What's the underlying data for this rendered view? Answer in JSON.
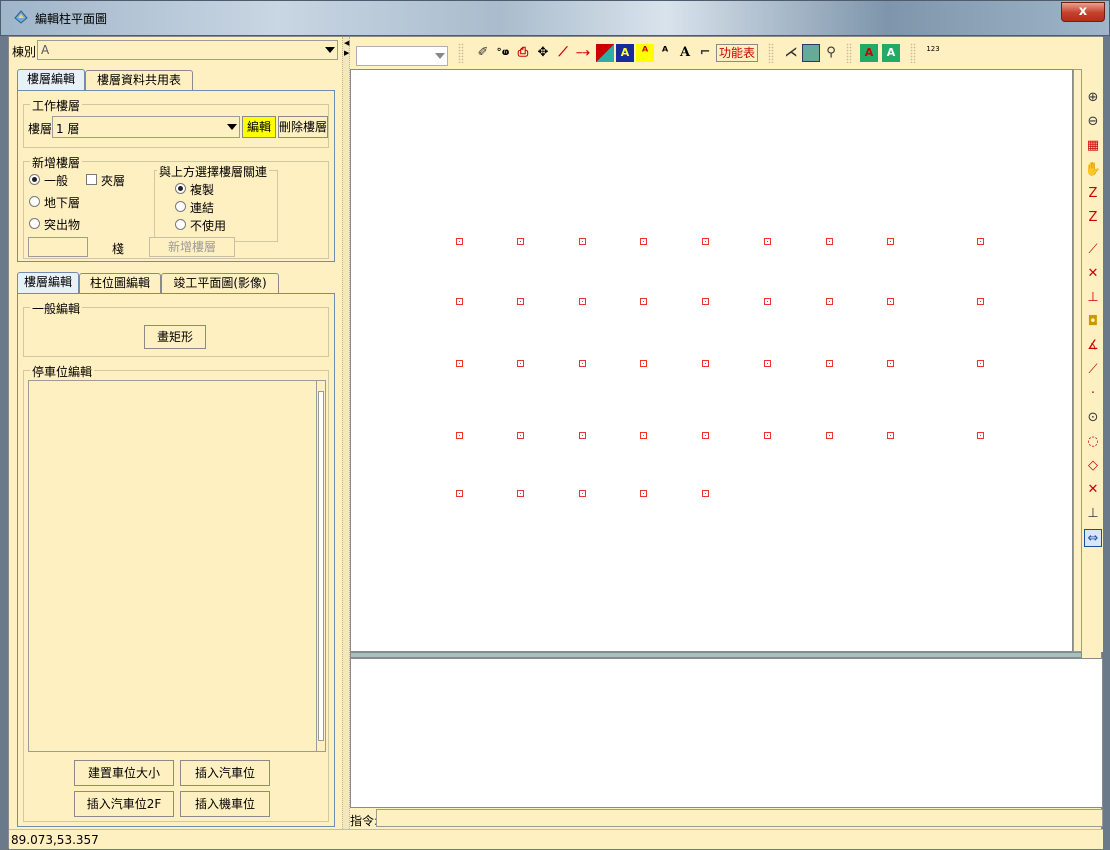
{
  "window": {
    "title": "編輯柱平面圖",
    "close": "x"
  },
  "left": {
    "building_label": "棟別",
    "building_value": "A",
    "top_tabs": [
      "樓層編輯",
      "樓層資料共用表"
    ],
    "work_floor": {
      "group_title": "工作樓層",
      "floor_label": "樓層",
      "floor_value": "1 層",
      "edit_button": "編輯",
      "delete_button": "刪除樓層"
    },
    "new_floor": {
      "group_title": "新增樓層",
      "types": [
        "一般",
        "地下層",
        "突出物"
      ],
      "selected_type": "一般",
      "mezzanine": "夾層",
      "relation_title": "與上方選擇樓層關連",
      "relations": [
        "複製",
        "連結",
        "不使用"
      ],
      "selected_relation": "複製",
      "count_value": "",
      "count_unit": "棧",
      "add_button": "新增樓層"
    },
    "bottom_tabs": [
      "樓層編輯",
      "柱位圖編輯",
      "竣工平面圖(影像)"
    ],
    "general_edit": {
      "group_title": "一般編輯",
      "draw_rect": "畫矩形"
    },
    "parking_edit": {
      "group_title": "停車位編輯",
      "items": []
    },
    "parking_buttons": [
      "建置車位大小",
      "插入汽車位",
      "插入汽車位2F",
      "插入機車位"
    ]
  },
  "toolbar": {
    "layer_combo_value": "",
    "function_table": "功能表",
    "icons": [
      "pencil-icon",
      "snap-icon",
      "stamp-icon",
      "move-icon",
      "line-icon",
      "extend-icon",
      "fill-icon",
      "text-red-icon",
      "text-style-icon",
      "text-angle-icon",
      "text-icon",
      "stairs-icon",
      "function-table",
      "polyline-icon",
      "layer-icon",
      "zoom-icon",
      "text-green1-icon",
      "text-green2-icon",
      "ruler-icon"
    ],
    "ruler_number": "123"
  },
  "canvas": {
    "grid_rows": [
      [
        true,
        true,
        true,
        true,
        true,
        true,
        true,
        true,
        true
      ],
      [
        true,
        true,
        true,
        true,
        true,
        true,
        true,
        true,
        true
      ],
      [
        true,
        true,
        true,
        true,
        true,
        true,
        true,
        true,
        true
      ],
      [
        true,
        true,
        true,
        true,
        true,
        true,
        true,
        true,
        true
      ],
      [
        true,
        true,
        true,
        true,
        true,
        false,
        false,
        false,
        false
      ]
    ]
  },
  "right_tools": [
    "zoom-in-icon",
    "zoom-out-icon",
    "zoom-window-icon",
    "pan-icon",
    "zoom-z1-icon",
    "zoom-z2-icon",
    "line-tool-icon",
    "cross-icon",
    "perpendicular-icon",
    "node-icon",
    "angle-icon",
    "tangent-icon",
    "point-icon",
    "circle-center-icon",
    "circle-tangent-icon",
    "quadrant-icon",
    "intersection-icon",
    "perpendicular2-icon",
    "dimension-icon"
  ],
  "command": {
    "label": "指令:",
    "value": ""
  },
  "status": {
    "coords": "89.073,53.357"
  },
  "colors": {
    "panel_bg": "#fff0c2",
    "column_mark": "#ee3333",
    "yellow_button": "#ffff00"
  }
}
